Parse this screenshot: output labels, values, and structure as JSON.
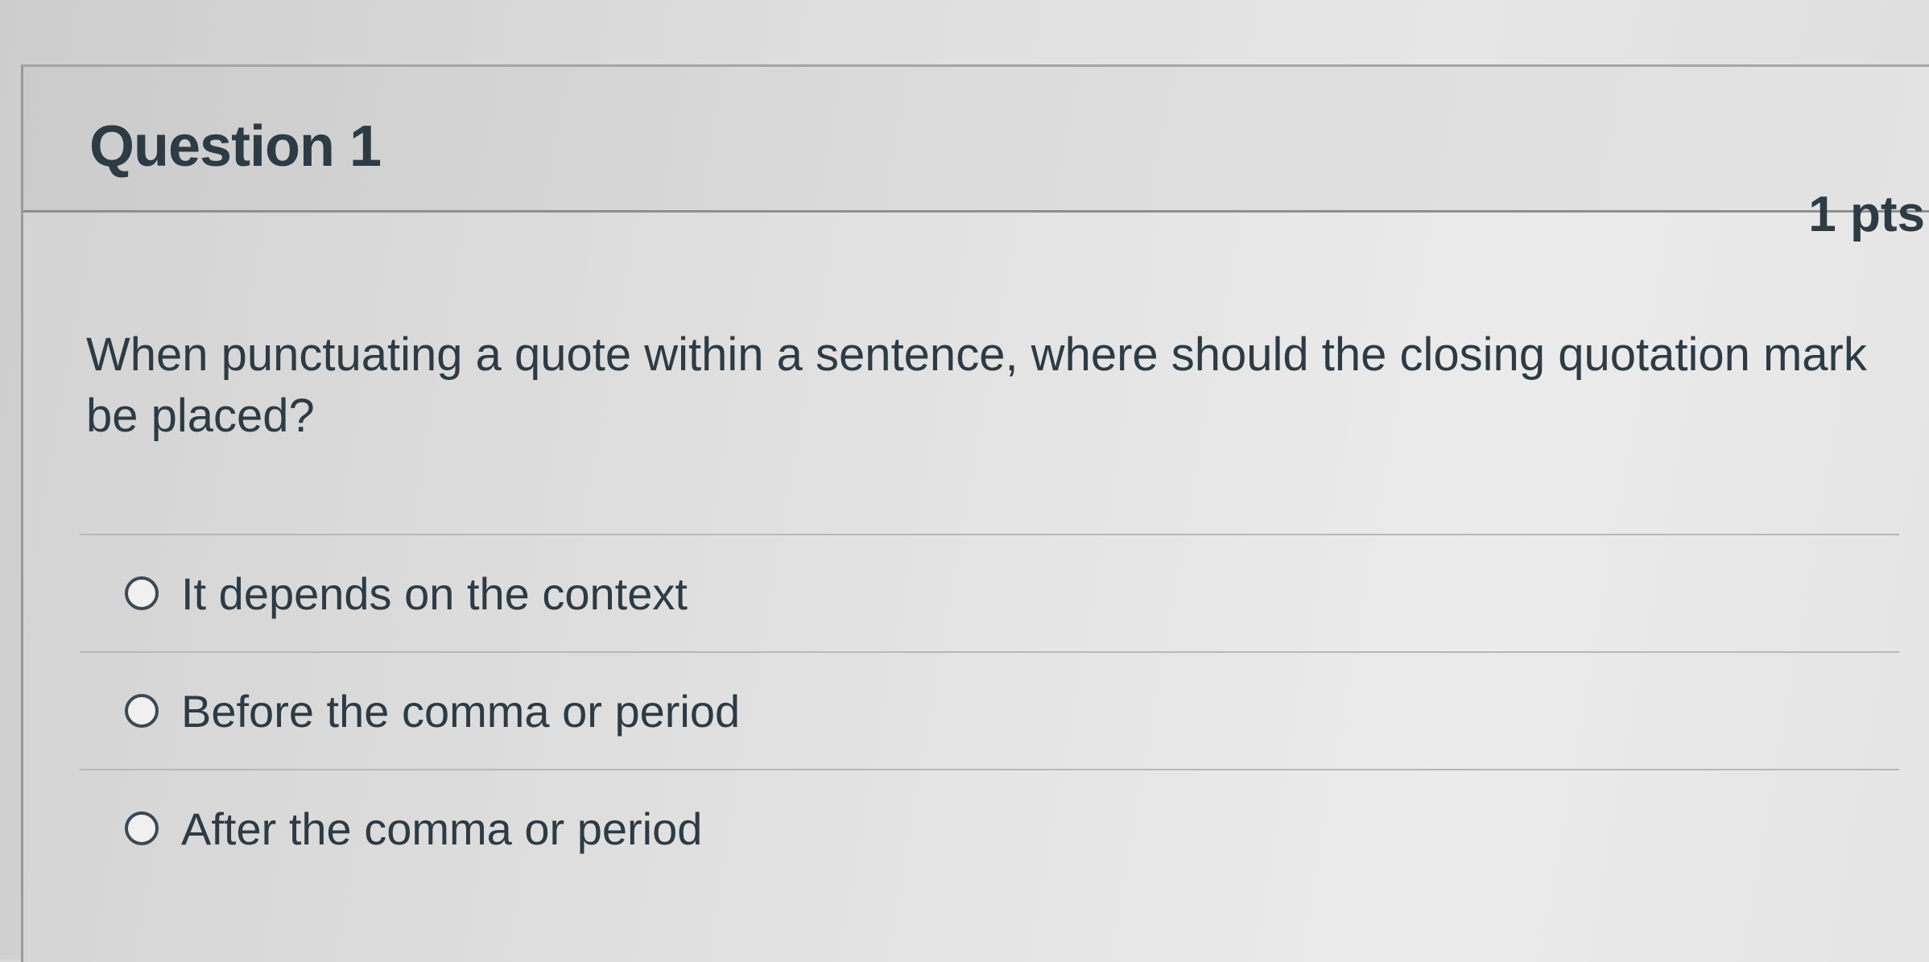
{
  "question": {
    "title": "Question 1",
    "points": "1 pts",
    "text": "When punctuating a quote within a sentence, where should the closing quotation mark be placed?"
  },
  "answers": [
    {
      "label": "It depends on the context",
      "selected": false
    },
    {
      "label": "Before the comma or period",
      "selected": false
    },
    {
      "label": "After the comma or period",
      "selected": false
    }
  ]
}
